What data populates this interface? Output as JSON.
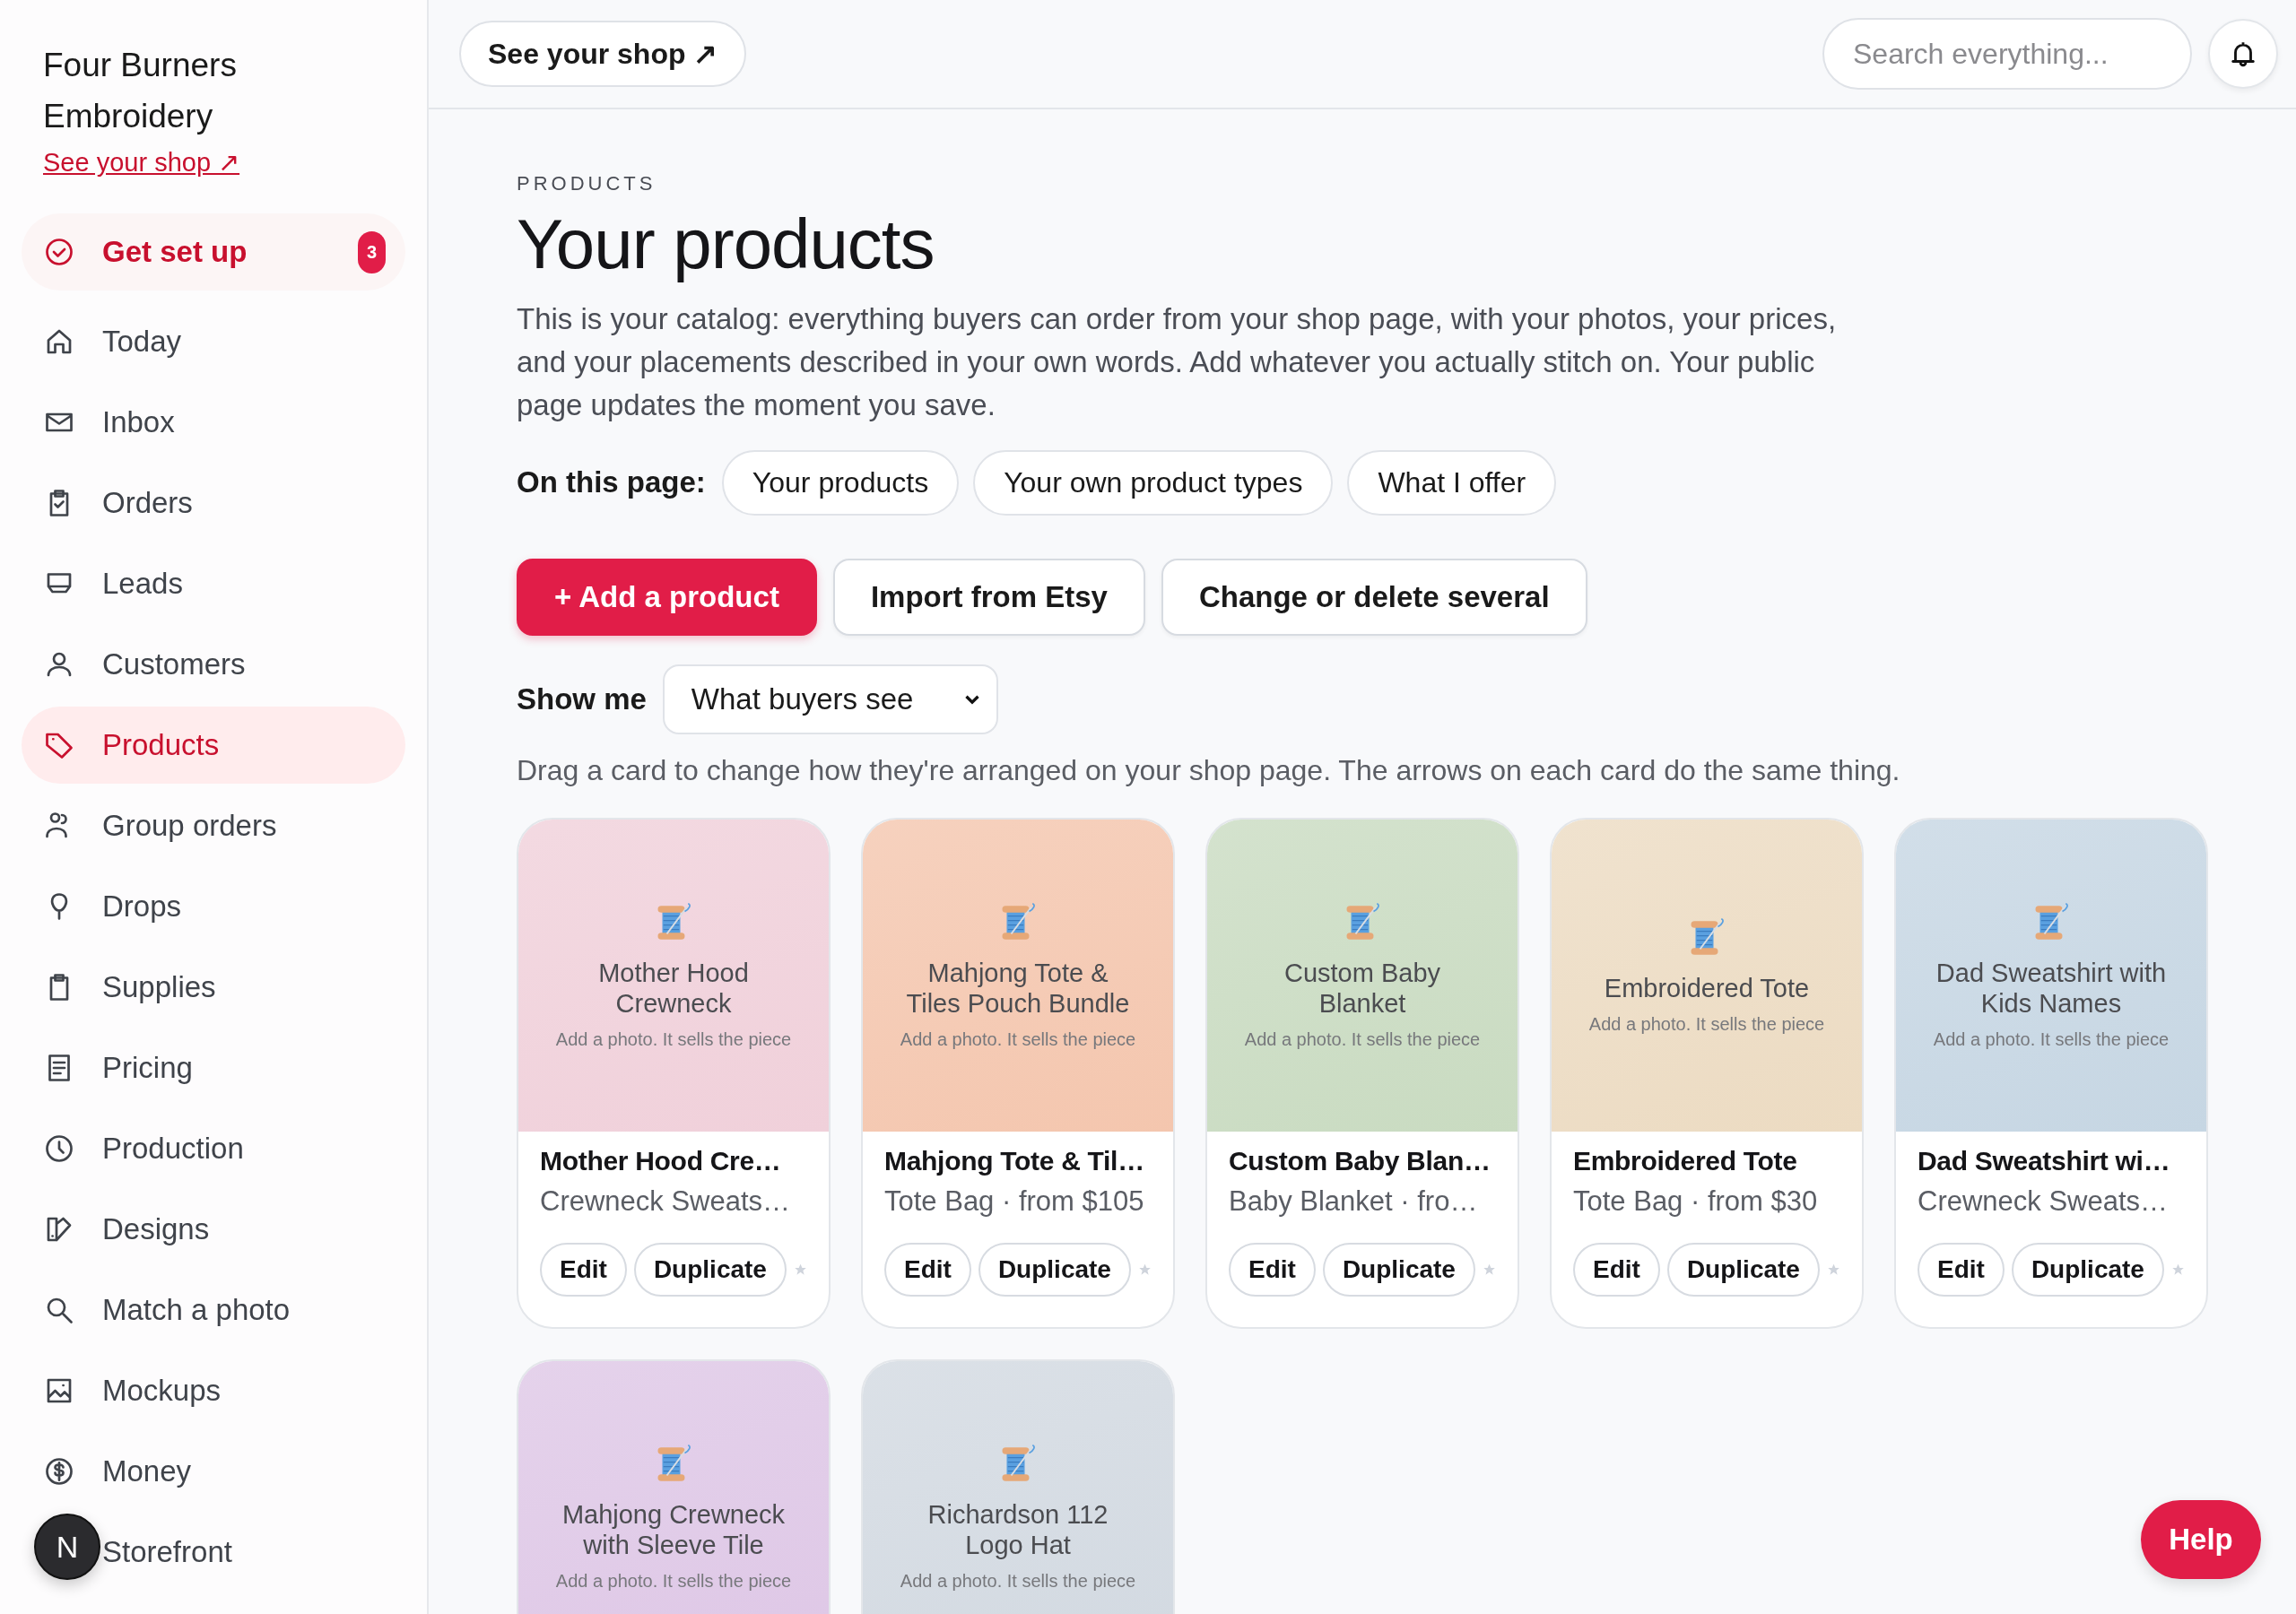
{
  "sidebar": {
    "brand": "Four Burners Embroidery",
    "shop_link": "See your shop ↗",
    "setup": {
      "label": "Get set up",
      "badge": "3"
    },
    "items": [
      {
        "label": "Today",
        "selected": false
      },
      {
        "label": "Inbox",
        "selected": false
      },
      {
        "label": "Orders",
        "selected": false
      },
      {
        "label": "Leads",
        "selected": false
      },
      {
        "label": "Customers",
        "selected": false
      },
      {
        "label": "Products",
        "selected": true
      },
      {
        "label": "Group orders",
        "selected": false
      },
      {
        "label": "Drops",
        "selected": false
      },
      {
        "label": "Supplies",
        "selected": false
      },
      {
        "label": "Pricing",
        "selected": false
      },
      {
        "label": "Production",
        "selected": false
      },
      {
        "label": "Designs",
        "selected": false
      },
      {
        "label": "Match a photo",
        "selected": false
      },
      {
        "label": "Mockups",
        "selected": false
      },
      {
        "label": "Money",
        "selected": false
      },
      {
        "label": "Storefront",
        "selected": false
      }
    ]
  },
  "top_bar": {
    "shop_button": "See your shop ↗",
    "search": {
      "placeholder": "Search everything..."
    }
  },
  "page": {
    "eyebrow": "PRODUCTS",
    "title": "Your products",
    "description": "This is your catalog: everything buyers can order from your shop page, with your photos, your prices, and your placements described in your own words. Add whatever you actually stitch on. Your public page updates the moment you save.",
    "jump_label": "On this page:",
    "jump_links": [
      "Your products",
      "Your own product types",
      "What I offer"
    ],
    "actions": [
      {
        "label": "+ Add a product",
        "kind": "primary"
      },
      {
        "label": "Import from Etsy",
        "kind": "secondary"
      },
      {
        "label": "Change or delete several",
        "kind": "secondary"
      }
    ],
    "view_label": "Show me",
    "view_select": "What buyers see",
    "hint": "Drag a card to change how they're arranged on your shop page. The arrows on each card do the same thing."
  },
  "products": [
    {
      "image_title": "Mother Hood Crewneck",
      "image_hint": "Add a photo. It sells the piece",
      "color": "#f0d0da",
      "name": "Mother Hood Cre…",
      "detail": "Crewneck Sweats…",
      "buttons": [
        "Edit",
        "Duplicate"
      ]
    },
    {
      "image_title": "Mahjong Tote & Tiles Pouch Bundle",
      "image_hint": "Add a photo. It sells the piece",
      "color": "#f4c6ae",
      "name": "Mahjong Tote & Til…",
      "detail": "Tote Bag · from $105",
      "buttons": [
        "Edit",
        "Duplicate"
      ]
    },
    {
      "image_title": "Custom Baby Blanket",
      "image_hint": "Add a photo. It sells the piece",
      "color": "#c9dbc1",
      "name": "Custom Baby Blan…",
      "detail": "Baby Blanket · fro…",
      "buttons": [
        "Edit",
        "Duplicate"
      ]
    },
    {
      "image_title": "Embroidered Tote",
      "image_hint": "Add a photo. It sells the piece",
      "color": "#ecdbc2",
      "name": "Embroidered Tote",
      "detail": "Tote Bag · from $30",
      "buttons": [
        "Edit",
        "Duplicate"
      ]
    },
    {
      "image_title": "Dad Sweatshirt with Kids Names",
      "image_hint": "Add a photo. It sells the piece",
      "color": "#c6d6e3",
      "name": "Dad Sweatshirt wi…",
      "detail": "Crewneck Sweats…",
      "buttons": [
        "Edit",
        "Duplicate"
      ]
    },
    {
      "image_title": "Mahjong Crewneck with Sleeve Tile",
      "image_hint": "Add a photo. It sells the piece",
      "color": "#dec7e6"
    },
    {
      "image_title": "Richardson 112 Logo Hat",
      "image_hint": "Add a photo. It sells the piece",
      "color": "#d2d9e1"
    }
  ],
  "dev_badge": "N",
  "help_button": "Help"
}
